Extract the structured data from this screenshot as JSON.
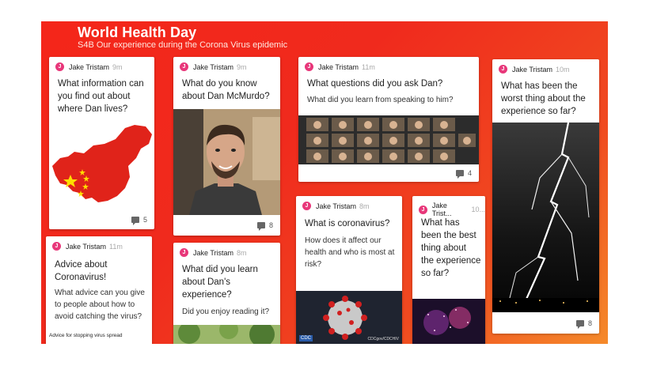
{
  "board": {
    "title": "World Health Day",
    "subtitle": "S4B Our experience during the Corona Virus epidemic",
    "background": "#f4261a"
  },
  "avatar_letter": "J",
  "cards": [
    {
      "author": "Jake Tristam",
      "time": "9m",
      "title": "What information can you find out about where Dan lives?",
      "image": "china-map-flag",
      "comments": "5"
    },
    {
      "author": "Jake Tristam",
      "time": "11m",
      "title": "Advice about Coronavirus!",
      "body": "What advice can you give to people about how to avoid catching the virus?",
      "caption": "Advice for stopping virus spread"
    },
    {
      "author": "Jake Tristam",
      "time": "9m",
      "title": "What do you know about Dan McMurdo?",
      "image": "portrait-photo",
      "comments": "8"
    },
    {
      "author": "Jake Tristam",
      "time": "8m",
      "title": "What did you learn about Dan's experience?",
      "body": "Did you enjoy reading it?",
      "image": "park-photo"
    },
    {
      "author": "Jake Tristam",
      "time": "11m",
      "title": "What questions did you ask Dan?",
      "body": "What did you learn from speaking to him?",
      "image": "video-call-grid",
      "comments": "4"
    },
    {
      "author": "Jake Tristam",
      "time": "8m",
      "title": "What is coronavirus?",
      "body": "How does it affect our health and who is most at risk?",
      "image": "virus-illustration",
      "image_tag": "CDC",
      "image_credit": "CDCgov/CDCHIV"
    },
    {
      "author": "Jake Trist...",
      "time": "10...",
      "title": "What has been the best thing about the experience so far?",
      "image": "fireworks-photo"
    },
    {
      "author": "Jake Tristam",
      "time": "10m",
      "title": "What has been the worst thing about the experience so far?",
      "image": "lightning-photo",
      "comments": "8"
    }
  ]
}
